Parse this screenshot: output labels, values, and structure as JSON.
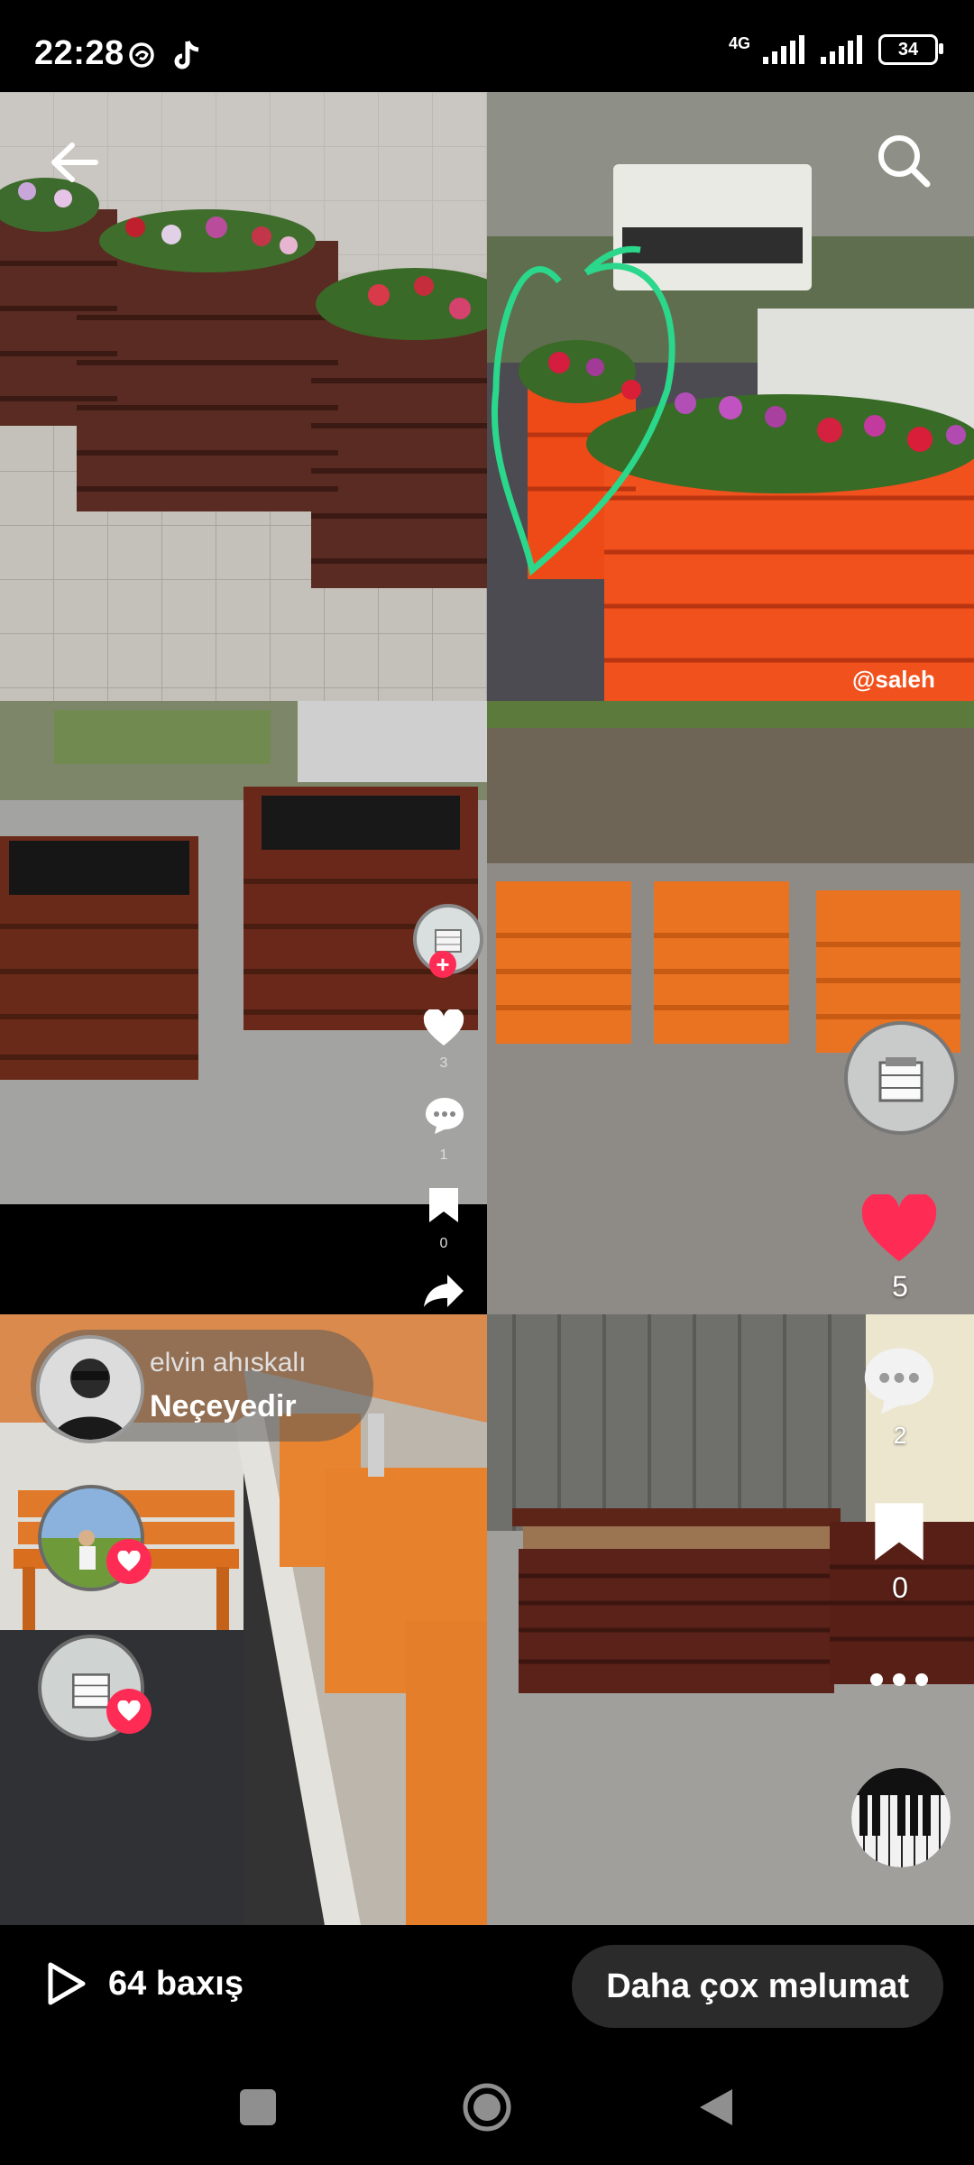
{
  "status_bar": {
    "time": "22:28",
    "network": "4G",
    "battery": "34"
  },
  "overlays": {
    "creator_name": "elvin ahıskalı",
    "video_title": "Neçeyedir",
    "watermark": "@saleh",
    "likes_small": "3",
    "comments_small": "1",
    "saves_small": "0",
    "likes": "5",
    "comments": "2",
    "saves": "0"
  },
  "bottom_bar": {
    "views": "64 baxış",
    "more_info": "Daha çox məlumat"
  }
}
